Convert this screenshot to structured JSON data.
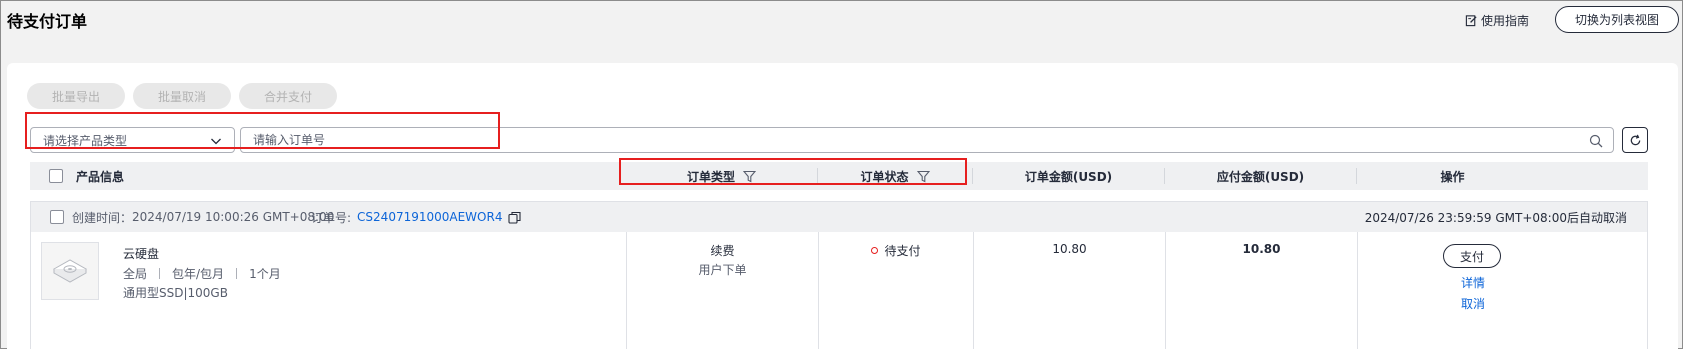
{
  "page": {
    "title": "待支付订单",
    "guide_label": "使用指南",
    "switch_view_label": "切换为列表视图"
  },
  "toolbar": {
    "batch_export": "批量导出",
    "batch_cancel": "批量取消",
    "merge_pay": "合并支付"
  },
  "filters": {
    "product_type_placeholder": "请选择产品类型",
    "order_no_placeholder": "请输入订单号"
  },
  "table": {
    "columns": [
      "产品信息",
      "订单类型",
      "订单状态",
      "订单金额(USD)",
      "应付金额(USD)",
      "操作"
    ]
  },
  "orders": [
    {
      "created_label": "创建时间：",
      "created_time": "2024/07/19 10:00:26 GMT+08:00",
      "order_no_label": "订单号:",
      "order_no": "CS2407191000AEWOR4",
      "auto_cancel": "2024/07/26 23:59:59 GMT+08:00后自动取消",
      "product_name": "云硬盘",
      "attrs": [
        "全局",
        "包年/包月",
        "1个月"
      ],
      "spec": "通用型SSD|100GB",
      "order_type": "续费",
      "order_source": "用户下单",
      "status": "待支付",
      "amount": "10.80",
      "payable": "10.80",
      "actions": {
        "pay": "支付",
        "detail": "详情",
        "cancel": "取消"
      }
    }
  ],
  "colors": {
    "link": "#0d65d8",
    "highlight_box": "#e61f1f",
    "status_dot": "#e61f1f"
  }
}
